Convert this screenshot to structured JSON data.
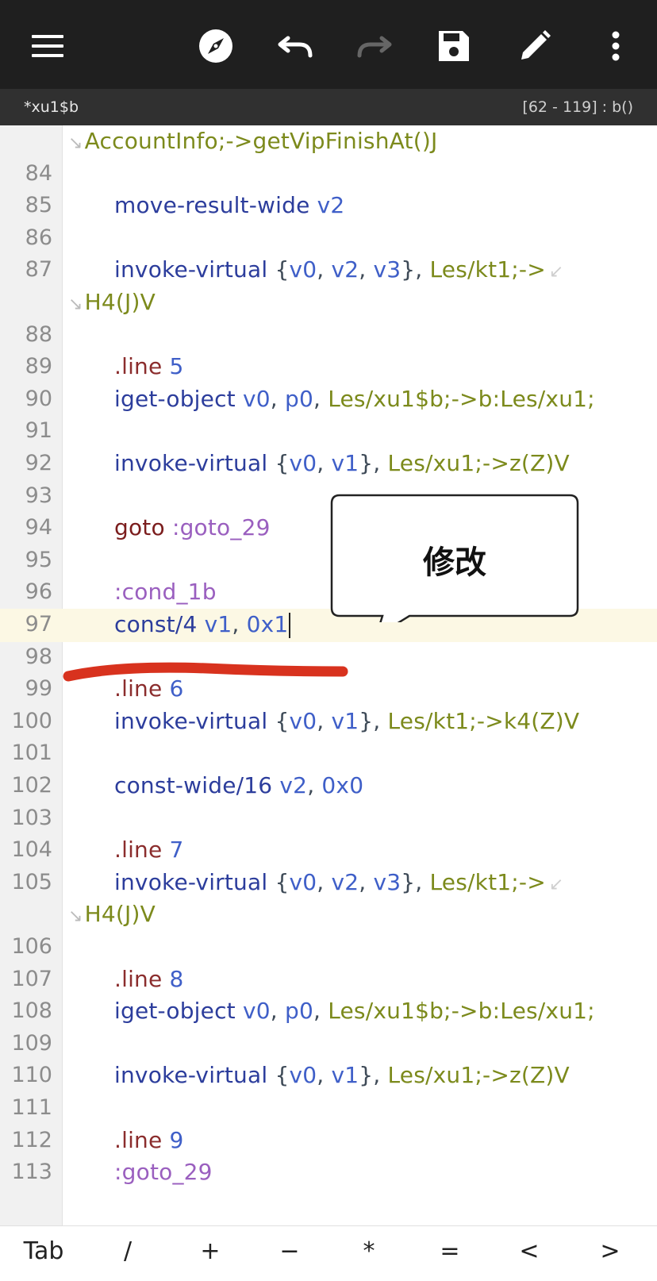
{
  "toolbar": {
    "menu_icon": "hamburger-menu-icon",
    "compass_icon": "compass-icon",
    "undo_icon": "undo-icon",
    "redo_icon": "redo-icon",
    "save_icon": "floppy-disk-icon",
    "edit_icon": "pencil-icon",
    "more_icon": "vertical-dots-icon"
  },
  "status": {
    "file_name": "*xu1$b",
    "position": "[62 - 119] : b()"
  },
  "editor": {
    "wrapped_first": {
      "parts": [
        "AccountInfo;->getVipFinishAt()J"
      ]
    },
    "lines": [
      {
        "num": "84",
        "parts": []
      },
      {
        "num": "85",
        "parts": [
          "move-result-wide",
          " ",
          "v2"
        ]
      },
      {
        "num": "86",
        "parts": []
      },
      {
        "num": "87",
        "parts": [
          "invoke-virtual",
          " {",
          "v0",
          ", ",
          "v2",
          ", ",
          "v3",
          "}, ",
          "Les/kt1;->"
        ],
        "wrap": [
          "H4(J)V"
        ]
      },
      {
        "num": "88",
        "parts": []
      },
      {
        "num": "89",
        "parts": [
          ".line",
          " ",
          "5"
        ]
      },
      {
        "num": "90",
        "parts": [
          "iget-object",
          " ",
          "v0",
          ", ",
          "p0",
          ", ",
          "Les/xu1$b;->b:Les/xu1;"
        ]
      },
      {
        "num": "91",
        "parts": []
      },
      {
        "num": "92",
        "parts": [
          "invoke-virtual",
          " {",
          "v0",
          ", ",
          "v1",
          "}, ",
          "Les/xu1;->z(Z)V"
        ]
      },
      {
        "num": "93",
        "parts": []
      },
      {
        "num": "94",
        "parts": [
          "goto",
          " ",
          ":goto_29"
        ]
      },
      {
        "num": "95",
        "parts": []
      },
      {
        "num": "96",
        "parts": [
          ":cond_1b"
        ]
      },
      {
        "num": "97",
        "parts": [
          "const/4",
          " ",
          "v1",
          ", ",
          "0x1"
        ]
      },
      {
        "num": "98",
        "parts": []
      },
      {
        "num": "99",
        "parts": [
          ".line",
          " ",
          "6"
        ]
      },
      {
        "num": "100",
        "parts": [
          "invoke-virtual",
          " {",
          "v0",
          ", ",
          "v1",
          "}, ",
          "Les/kt1;->k4(Z)V"
        ]
      },
      {
        "num": "101",
        "parts": []
      },
      {
        "num": "102",
        "parts": [
          "const-wide/16",
          " ",
          "v2",
          ", ",
          "0x0"
        ]
      },
      {
        "num": "103",
        "parts": []
      },
      {
        "num": "104",
        "parts": [
          ".line",
          " ",
          "7"
        ]
      },
      {
        "num": "105",
        "parts": [
          "invoke-virtual",
          " {",
          "v0",
          ", ",
          "v2",
          ", ",
          "v3",
          "}, ",
          "Les/kt1;->"
        ],
        "wrap": [
          "H4(J)V"
        ]
      },
      {
        "num": "106",
        "parts": []
      },
      {
        "num": "107",
        "parts": [
          ".line",
          " ",
          "8"
        ]
      },
      {
        "num": "108",
        "parts": [
          "iget-object",
          " ",
          "v0",
          ", ",
          "p0",
          ", ",
          "Les/xu1$b;->b:Les/xu1;"
        ]
      },
      {
        "num": "109",
        "parts": []
      },
      {
        "num": "110",
        "parts": [
          "invoke-virtual",
          " {",
          "v0",
          ", ",
          "v1",
          "}, ",
          "Les/xu1;->z(Z)V"
        ]
      },
      {
        "num": "111",
        "parts": []
      },
      {
        "num": "112",
        "parts": [
          ".line",
          " ",
          "9"
        ]
      },
      {
        "num": "113",
        "parts": [
          ":goto_29"
        ]
      }
    ]
  },
  "annotation": {
    "callout_text": "修改"
  },
  "keys": [
    "Tab",
    "/",
    "+",
    "−",
    "*",
    "=",
    "<",
    ">"
  ],
  "colors": {
    "toolbar_bg": "#1f1f1f",
    "status_bg": "#303030",
    "instruction": "#2c3d9c",
    "register": "#3f5fc8",
    "type_ref": "#7c8a1c",
    "label": "#9a5fbf",
    "directive": "#8b2d2d",
    "highlight_line": "#fcf8e4",
    "annotation_red": "#d8321e"
  }
}
